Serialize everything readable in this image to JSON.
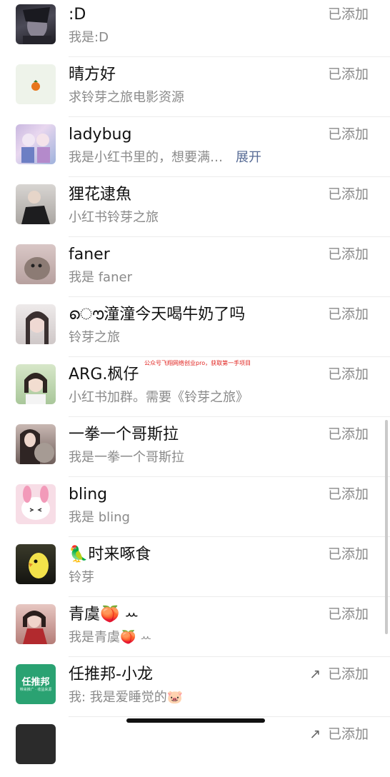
{
  "contacts": [
    {
      "name": ":D",
      "sub": "我是:D",
      "status": "已添加"
    },
    {
      "name": "晴方好",
      "sub": "求铃芽之旅电影资源",
      "status": "已添加"
    },
    {
      "name": "ladybug",
      "sub": "我是小红书里的，想要满…",
      "expand": "展开",
      "status": "已添加"
    },
    {
      "name": "狸花逮魚",
      "sub": "小红书铃芽之旅",
      "status": "已添加"
    },
    {
      "name": "faner",
      "sub": "我是 faner",
      "status": "已添加"
    },
    {
      "name": "ൌ潼潼今天喝牛奶了吗",
      "sub": "铃芽之旅",
      "status": "已添加"
    },
    {
      "name": "ARG.枫仔",
      "sub": "小红书加群。需要《铃芽之旅》",
      "status": "已添加"
    },
    {
      "name": "一拳一个哥斯拉",
      "sub": "我是一拳一个哥斯拉",
      "status": "已添加"
    },
    {
      "name": "bling",
      "sub": "我是 bling",
      "status": "已添加"
    },
    {
      "name": "🦜时来啄食",
      "sub": "铃芽",
      "status": "已添加"
    },
    {
      "name": "青虞🍑 ꕀ",
      "sub": "我是青虞🍑 ꕀ",
      "status": "已添加"
    },
    {
      "name": "任推邦-小龙",
      "sub": "我: 我是爱睡觉的🐷",
      "status": "已添加",
      "arrow": "↗"
    }
  ],
  "avatar_text": {
    "renbang_title": "任推邦",
    "renbang_tag": "带来推广 · 收益来源"
  },
  "watermark": "公众号飞翔网络创业pro，获取第一手项目",
  "colors": {
    "link": "#576b95",
    "status": "#8a8a8a",
    "watermark": "#e0201c"
  }
}
